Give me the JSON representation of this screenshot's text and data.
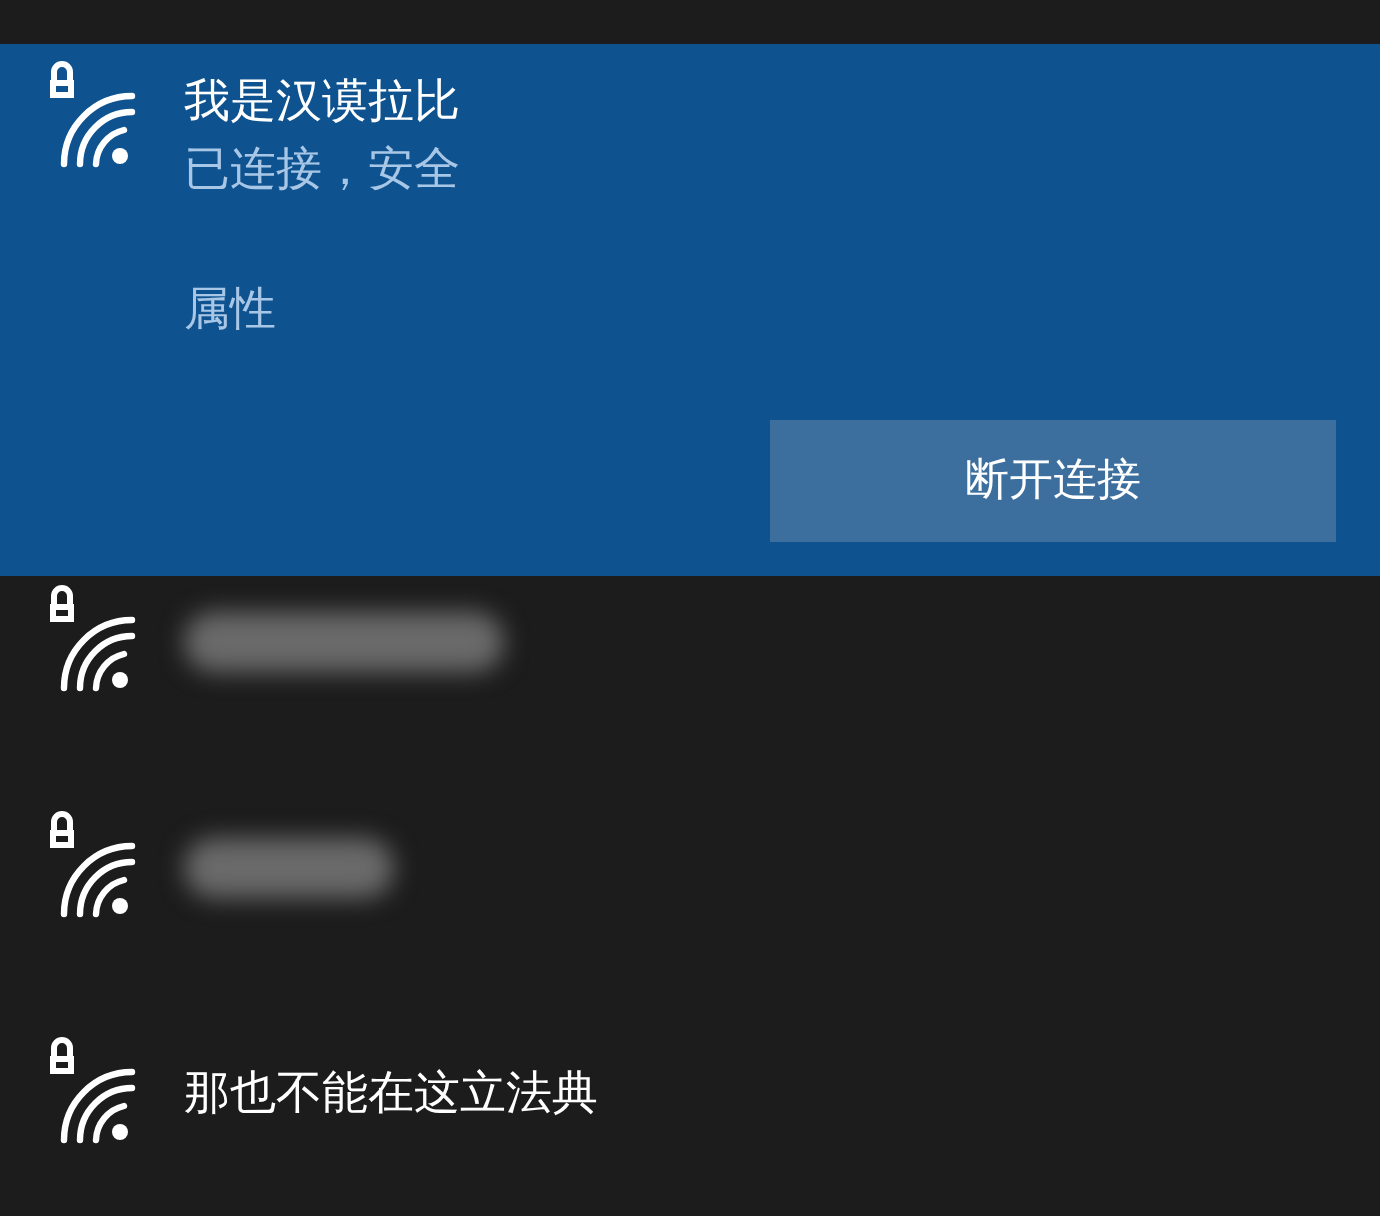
{
  "connected": {
    "name": "我是汉谟拉比",
    "status": "已连接，安全",
    "properties_link": "属性",
    "disconnect_button": "断开连接",
    "secured": true
  },
  "networks": [
    {
      "kind": "blurred",
      "secured": true
    },
    {
      "kind": "blurred",
      "secured": true
    },
    {
      "kind": "named",
      "name": "那也不能在这立法典",
      "secured": true
    }
  ]
}
